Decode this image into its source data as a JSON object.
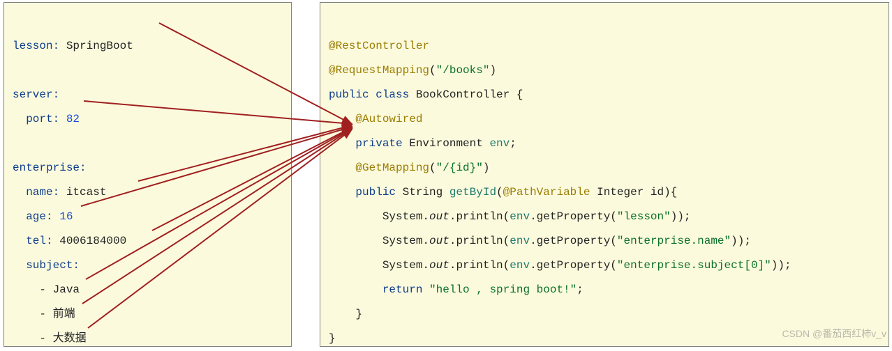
{
  "yaml": {
    "lesson_key": "lesson:",
    "lesson_val": " SpringBoot",
    "server_key": "server:",
    "port_key": "port:",
    "port_val": " 82",
    "enterprise_key": "enterprise:",
    "name_key": "name:",
    "name_val": " itcast",
    "age_key": "age:",
    "age_val": " 16",
    "tel_key": "tel:",
    "tel_val": " 4006184000",
    "subject_key": "subject:",
    "sub1": "- Java",
    "sub2": "- 前端",
    "sub3": "- 大数据"
  },
  "code": {
    "ann_rest": "@RestController",
    "ann_reqmap": "@RequestMapping",
    "reqmap_arg_open": "(",
    "reqmap_arg_str": "\"/books\"",
    "reqmap_arg_close": ")",
    "public": "public",
    "class_kw": "class",
    "class_name": " BookController ",
    "brace_open": "{",
    "ann_autowired": "@Autowired",
    "private": "private",
    "env_type": " Environment ",
    "env_var": "env",
    "semicolon": ";",
    "ann_getmap": "@GetMapping",
    "getmap_arg_str": "\"/{id}\"",
    "string_type": " String ",
    "method_name": "getById",
    "paren_open": "(",
    "ann_pathvar": "@PathVariable",
    "int_type": " Integer ",
    "id_param": "id",
    "paren_close_brace": "){",
    "sys": "System.",
    "out": "out",
    "println": ".println(",
    "envget": ".getProperty(",
    "prop1": "\"lesson\"",
    "prop2": "\"enterprise.name\"",
    "prop3": "\"enterprise.subject[0]\"",
    "close_call": "));",
    "return_kw": "return",
    "return_str": " \"hello , spring boot!\"",
    "return_semi": ";",
    "brace_close_inner": "}",
    "brace_close_outer": "}"
  },
  "watermark": "CSDN @番茄西红柿v_v"
}
